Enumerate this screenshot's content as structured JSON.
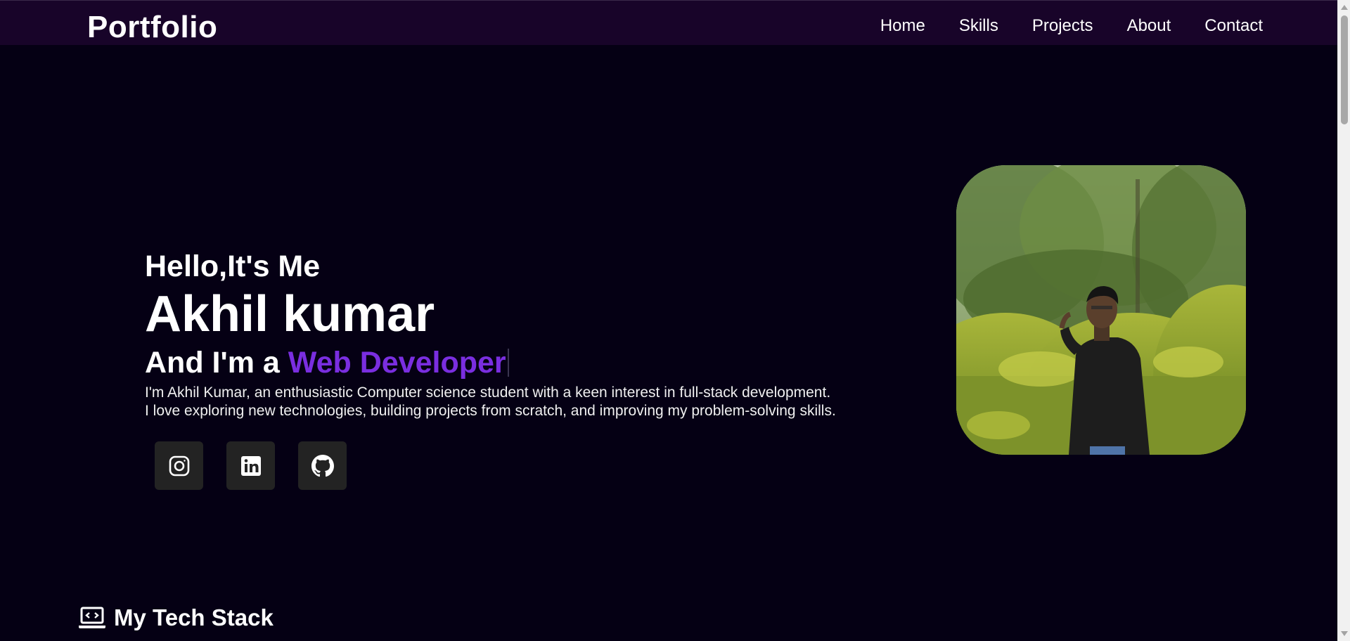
{
  "header": {
    "brand": "Portfolio",
    "nav": [
      "Home",
      "Skills",
      "Projects",
      "About",
      "Contact"
    ]
  },
  "hero": {
    "greeting": "Hello,It's Me",
    "name": "Akhil kumar",
    "role_prefix": "And I'm a",
    "role_highlight": "Web Developer",
    "bio_lines": [
      "I'm Akhil Kumar, an enthusiastic Computer science student with a keen interest in full-stack development.",
      "I love exploring new technologies, building projects from scratch, and improving my problem-solving skills."
    ],
    "socials": [
      {
        "icon": "instagram-icon"
      },
      {
        "icon": "linkedin-icon"
      },
      {
        "icon": "github-icon"
      }
    ],
    "photo": {
      "icon": "profile-photo"
    }
  },
  "tech_stack": {
    "title": "My Tech Stack",
    "icon": "laptop-code-icon"
  },
  "colors": {
    "background": "#050014",
    "navbar": "#180429",
    "accent": "#7a2ee0",
    "social_button": "#232323"
  }
}
